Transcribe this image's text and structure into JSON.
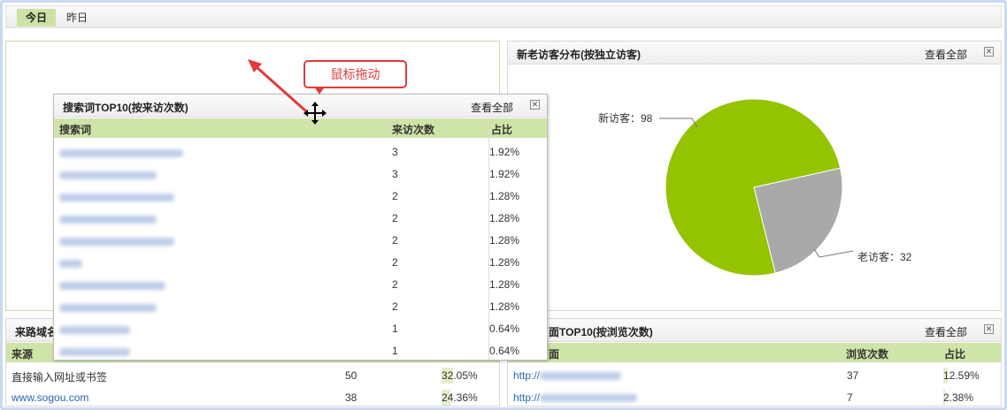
{
  "tabs": [
    {
      "label": "今日"
    },
    {
      "label": "昨日"
    }
  ],
  "search_panel": {
    "title": "搜索词TOP10(按来访次数)",
    "view_all": "查看全部",
    "columns": [
      "搜索词",
      "来访次数",
      "占比"
    ],
    "rows": [
      {
        "count": "3",
        "pct": "1.92%",
        "pct_value": 1.92
      },
      {
        "count": "3",
        "pct": "1.92%",
        "pct_value": 1.92
      },
      {
        "count": "2",
        "pct": "1.28%",
        "pct_value": 1.28
      },
      {
        "count": "2",
        "pct": "1.28%",
        "pct_value": 1.28
      },
      {
        "count": "2",
        "pct": "1.28%",
        "pct_value": 1.28
      },
      {
        "count": "2",
        "pct": "1.28%",
        "pct_value": 1.28
      },
      {
        "count": "2",
        "pct": "1.28%",
        "pct_value": 1.28
      },
      {
        "count": "2",
        "pct": "1.28%",
        "pct_value": 1.28
      },
      {
        "count": "1",
        "pct": "0.64%",
        "pct_value": 0.64
      },
      {
        "count": "1",
        "pct": "0.64%",
        "pct_value": 0.64
      }
    ]
  },
  "callout": {
    "text": "鼠标拖动"
  },
  "visitor_panel": {
    "title": "新老访客分布(按独立访客)",
    "view_all": "查看全部",
    "new_label": "新访客：98",
    "old_label": "老访客：32"
  },
  "chart_data": {
    "type": "pie",
    "slices": [
      {
        "name": "新访客",
        "value": 98,
        "color": "#94c300"
      },
      {
        "name": "老访客",
        "value": 32,
        "color": "#a9a9a9"
      }
    ]
  },
  "source_panel": {
    "title_visible": "来路域名",
    "columns": [
      "来源"
    ],
    "rows": [
      {
        "source": "直接输入网址或书签",
        "count": "50",
        "pct": "32.05%",
        "pct_value": 32.05
      },
      {
        "source": "www.sogou.com",
        "count": "38",
        "pct": "24.36%",
        "pct_value": 24.36
      }
    ]
  },
  "page_panel": {
    "title_visible": "面TOP10(按浏览次数)",
    "view_all": "查看全部",
    "columns": [
      "面",
      "浏览次数",
      "占比"
    ],
    "rows": [
      {
        "url": "http://",
        "count": "37",
        "pct": "12.59%",
        "pct_value": 12.59
      },
      {
        "url": "http://",
        "count": "7",
        "pct": "2.38%",
        "pct_value": 2.38
      }
    ]
  },
  "colors": {
    "accent_green": "#cfe4a8",
    "arrow_red": "#e23a3a",
    "link_blue": "#2d64b3"
  }
}
